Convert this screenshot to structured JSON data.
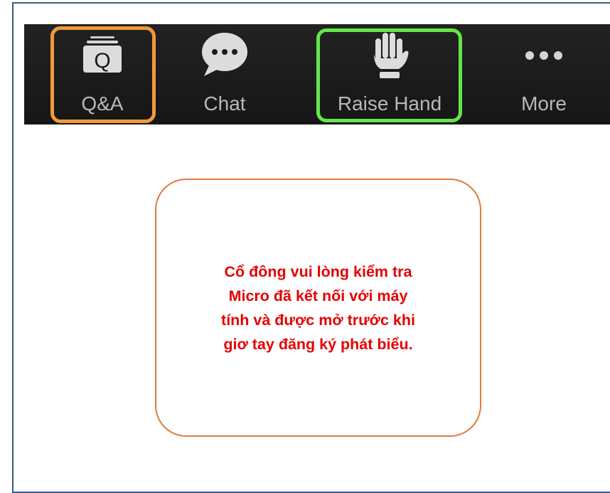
{
  "toolbar": {
    "items": [
      {
        "label": "Q&A",
        "icon": "qa-icon",
        "icon_glyph": "Q"
      },
      {
        "label": "Chat",
        "icon": "chat-icon",
        "icon_glyph": "•••"
      },
      {
        "label": "Raise Hand",
        "icon": "raise-hand-icon"
      },
      {
        "label": "More",
        "icon": "more-icon",
        "icon_glyph": "•••"
      }
    ],
    "highlight_colors": {
      "qa": "#f29a3a",
      "raise_hand": "#62e64a"
    }
  },
  "notice": {
    "lines": [
      "Cổ đông vui lòng kiểm tra",
      "Micro đã kết nối với máy",
      "tính và được mở trước khi",
      "giơ tay đăng ký phát biểu."
    ],
    "text_color": "#e60000",
    "border_color": "#e07b3b"
  }
}
